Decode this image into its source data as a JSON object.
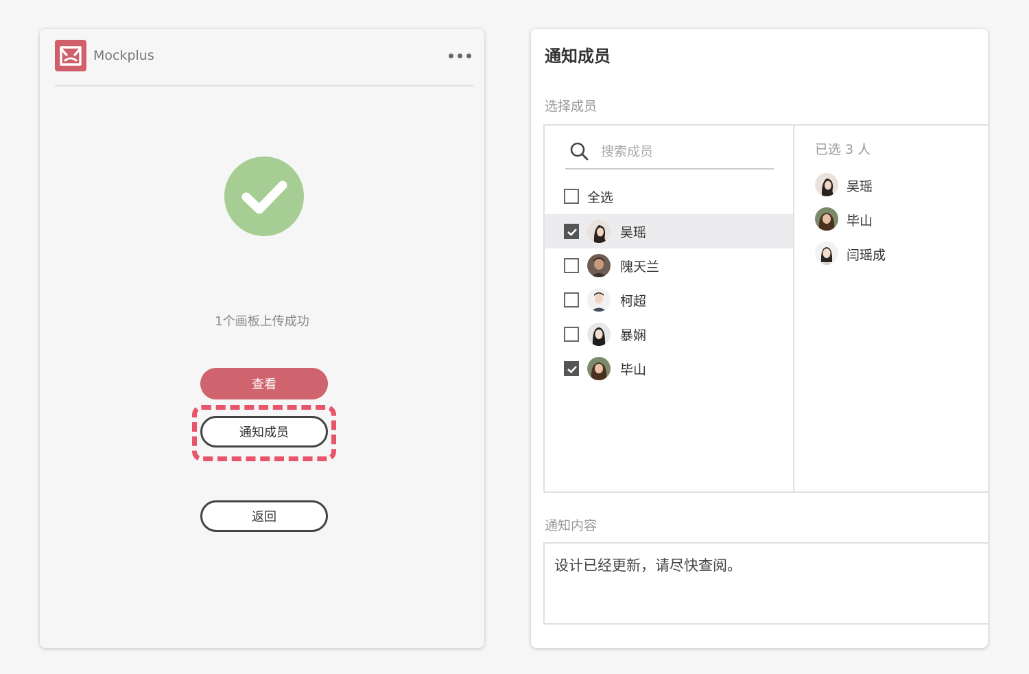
{
  "left": {
    "brand": "Mockplus",
    "success_text": "1个画板上传成功",
    "view_label": "查看",
    "notify_label": "通知成员",
    "back_label": "返回"
  },
  "right": {
    "title": "通知成员",
    "select_label": "选择成员",
    "search_placeholder": "搜索成员",
    "select_all": "全选",
    "members": [
      {
        "name": "吴瑶",
        "checked": true
      },
      {
        "name": "隗天兰",
        "checked": false
      },
      {
        "name": "柯超",
        "checked": false
      },
      {
        "name": "暴娴",
        "checked": false
      },
      {
        "name": "毕山",
        "checked": true
      }
    ],
    "selected_count": "已选 3 人",
    "selected": [
      "吴瑶",
      "毕山",
      "闫瑶成"
    ],
    "content_label": "通知内容",
    "content_text": "设计已经更新，请尽快查阅。"
  },
  "colors": {
    "brand": "#cf5f6b",
    "primary_button": "#cf636e",
    "success": "#a6cd93",
    "highlight_dash": "#e8556b"
  },
  "icons": [
    "mockplus-logo-icon",
    "more-icon",
    "check-circle-icon",
    "search-icon",
    "checkbox-icon",
    "avatar"
  ]
}
